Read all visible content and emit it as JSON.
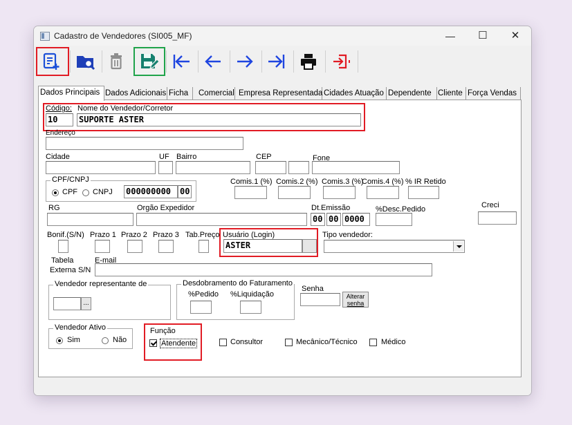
{
  "window": {
    "title": "Cadastro de Vendedores (SI005_MF)",
    "minimize": "—",
    "maximize": "☐",
    "close": "✕"
  },
  "toolbar": {
    "buttons": [
      "new-record-icon",
      "search-folder-icon",
      "delete-icon",
      "save-edit-icon",
      "first-record-icon",
      "previous-record-icon",
      "next-record-icon",
      "last-record-icon",
      "print-icon",
      "exit-icon"
    ],
    "accent_red": "#e11b24",
    "accent_green": "#1fa34a",
    "nav_blue": "#1f45e0",
    "save_teal": "#15806e"
  },
  "tabs": [
    "Dados Principais",
    "Dados Adicionais",
    "Ficha",
    "Comercial",
    "Empresa Representada",
    "Cidades Atuação",
    "Dependente",
    "Cliente",
    "Força Vendas"
  ],
  "form": {
    "codigo": {
      "label": "Código:",
      "value": "10"
    },
    "nome": {
      "label": "Nome do Vendedor/Corretor",
      "value": "SUPORTE ASTER"
    },
    "endereco": {
      "label": "Endereço",
      "value": ""
    },
    "cidade": {
      "label": "Cidade"
    },
    "uf": {
      "label": "UF"
    },
    "bairro": {
      "label": "Bairro"
    },
    "cep": {
      "label": "CEP"
    },
    "fone": {
      "label": "Fone"
    },
    "cpf_cnpj": {
      "label": "CPF/CNPJ",
      "cpf": "CPF",
      "cnpj": "CNPJ",
      "value": "000000000",
      "value2": "00"
    },
    "comis1": {
      "label": "Comis.1 (%)"
    },
    "comis2": {
      "label": "Comis.2 (%)"
    },
    "comis3": {
      "label": "Comis.3 (%)"
    },
    "comis4": {
      "label": "Comis.4 (%)"
    },
    "ir_retido": {
      "label": "% IR Retido"
    },
    "rg": {
      "label": "RG"
    },
    "orgao": {
      "label": "Orgão Expedidor"
    },
    "dt_emissao": {
      "label": "Dt.Emissão",
      "day": "00",
      "month": "00",
      "year": "0000"
    },
    "desc_pedido": {
      "label": "%Desc.Pedido"
    },
    "creci": {
      "label": "Creci"
    },
    "bonif": {
      "label": "Bonif.(S/N)"
    },
    "prazo1": {
      "label": "Prazo 1"
    },
    "prazo2": {
      "label": "Prazo 2"
    },
    "prazo3": {
      "label": "Prazo 3"
    },
    "tab_preco": {
      "label": "Tab.Preço"
    },
    "usuario": {
      "label": "Usuário (Login)",
      "value": "ASTER"
    },
    "tipo_vendedor": {
      "label": "Tipo vendedor:",
      "value": ""
    },
    "tabela_externa": {
      "label1": "Tabela",
      "label2": "Externa S/N"
    },
    "email": {
      "label": "E-mail"
    },
    "vendedor_representante": {
      "label": "Vendedor representante de",
      "button": "..."
    },
    "desdobramento": {
      "label": "Desdobramento do Faturamento",
      "pedido": "%Pedido",
      "liquidacao": "%Liquidação"
    },
    "senha": {
      "label": "Senha",
      "button_line1": "Alterar",
      "button_line2": "senha"
    },
    "vendedor_ativo": {
      "label": "Vendedor Ativo",
      "sim": "Sim",
      "nao": "Não",
      "selected": "Sim"
    },
    "funcao": {
      "label": "Função",
      "atendente": "Atendente",
      "consultor": "Consultor",
      "mecanico": "Mecânico/Técnico",
      "medico": "Médico",
      "checked": [
        "Atendente"
      ]
    }
  }
}
